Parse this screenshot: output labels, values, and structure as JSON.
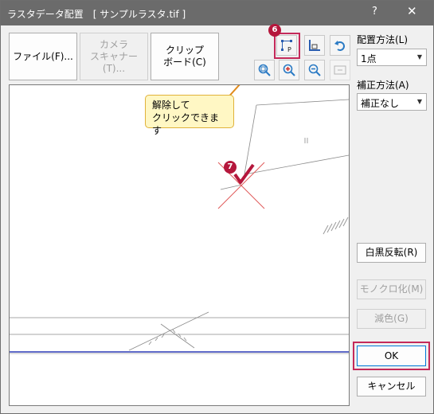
{
  "window": {
    "title": "ラスタデータ配置　[ サンプルラスタ.tif ]",
    "help_label": "?",
    "close_label": "✕"
  },
  "source_buttons": {
    "file": "ファイル(F)...",
    "camera": "カメラ\nスキャナー(T)...",
    "clipboard": "クリップ\nボード(C)"
  },
  "toolbar": {
    "icons": [
      "unlock-placement-icon",
      "corner-align-icon",
      "undo-icon",
      "zoom-fit-icon",
      "zoom-in-icon",
      "zoom-out-icon",
      "actual-size-icon"
    ]
  },
  "placement_method": {
    "label": "配置方法(L)",
    "value": "1点"
  },
  "correction_method": {
    "label": "補正方法(A)",
    "value": "補正なし"
  },
  "side_buttons": {
    "invert": "白黒反転(R)",
    "monochrome": "モノクロ化(M)",
    "reduce_colors": "減色(G)",
    "ok": "OK",
    "cancel": "キャンセル"
  },
  "annotations": {
    "callout_text": "解除して\nクリックできます",
    "step6": "6",
    "step7": "7",
    "highlight_color": "#c42a5a",
    "callout_color": "#fff7c4"
  }
}
